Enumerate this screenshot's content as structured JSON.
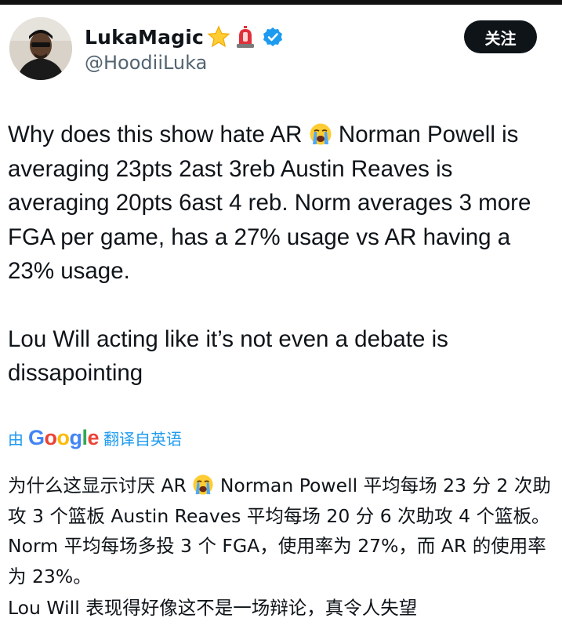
{
  "user": {
    "display_name": "LukaMagic",
    "handle": "@HoodiiLuka",
    "badges": [
      "star-emoji",
      "siren-emoji",
      "verified-badge"
    ],
    "verified_color": "#1d9bf0"
  },
  "follow_button": {
    "label": "关注"
  },
  "tweet": {
    "paragraph1_before_emoji": "Why does this show hate AR ",
    "paragraph1_after_emoji": " Norman Powell is averaging 23pts 2ast 3reb Austin Reaves is averaging 20pts 6ast 4 reb. Norm averages 3 more FGA per game, has a 27% usage vs AR having a 23% usage.",
    "paragraph2": "Lou Will acting like it’s not even a debate is dissapointing",
    "emoji": "loudly-crying-face"
  },
  "translation": {
    "prefix": "由",
    "brand": "Google",
    "suffix": "翻译自英语",
    "paragraph1_before_emoji": "为什么这显示讨厌 AR ",
    "paragraph1_after_emoji": " Norman Powell 平均每场 23 分 2 次助攻 3 个篮板 Austin Reaves 平均每场 20 分 6 次助攻 4 个篮板。Norm 平均每场多投 3 个 FGA，使用率为 27%，而 AR 的使用率为 23%。",
    "paragraph2": "Lou Will 表现得好像这不是一场辩论，真令人失望"
  },
  "colors": {
    "text": "#0f1419",
    "secondary": "#536471",
    "link": "#1d9bf0",
    "follow_bg": "#0f1419"
  }
}
